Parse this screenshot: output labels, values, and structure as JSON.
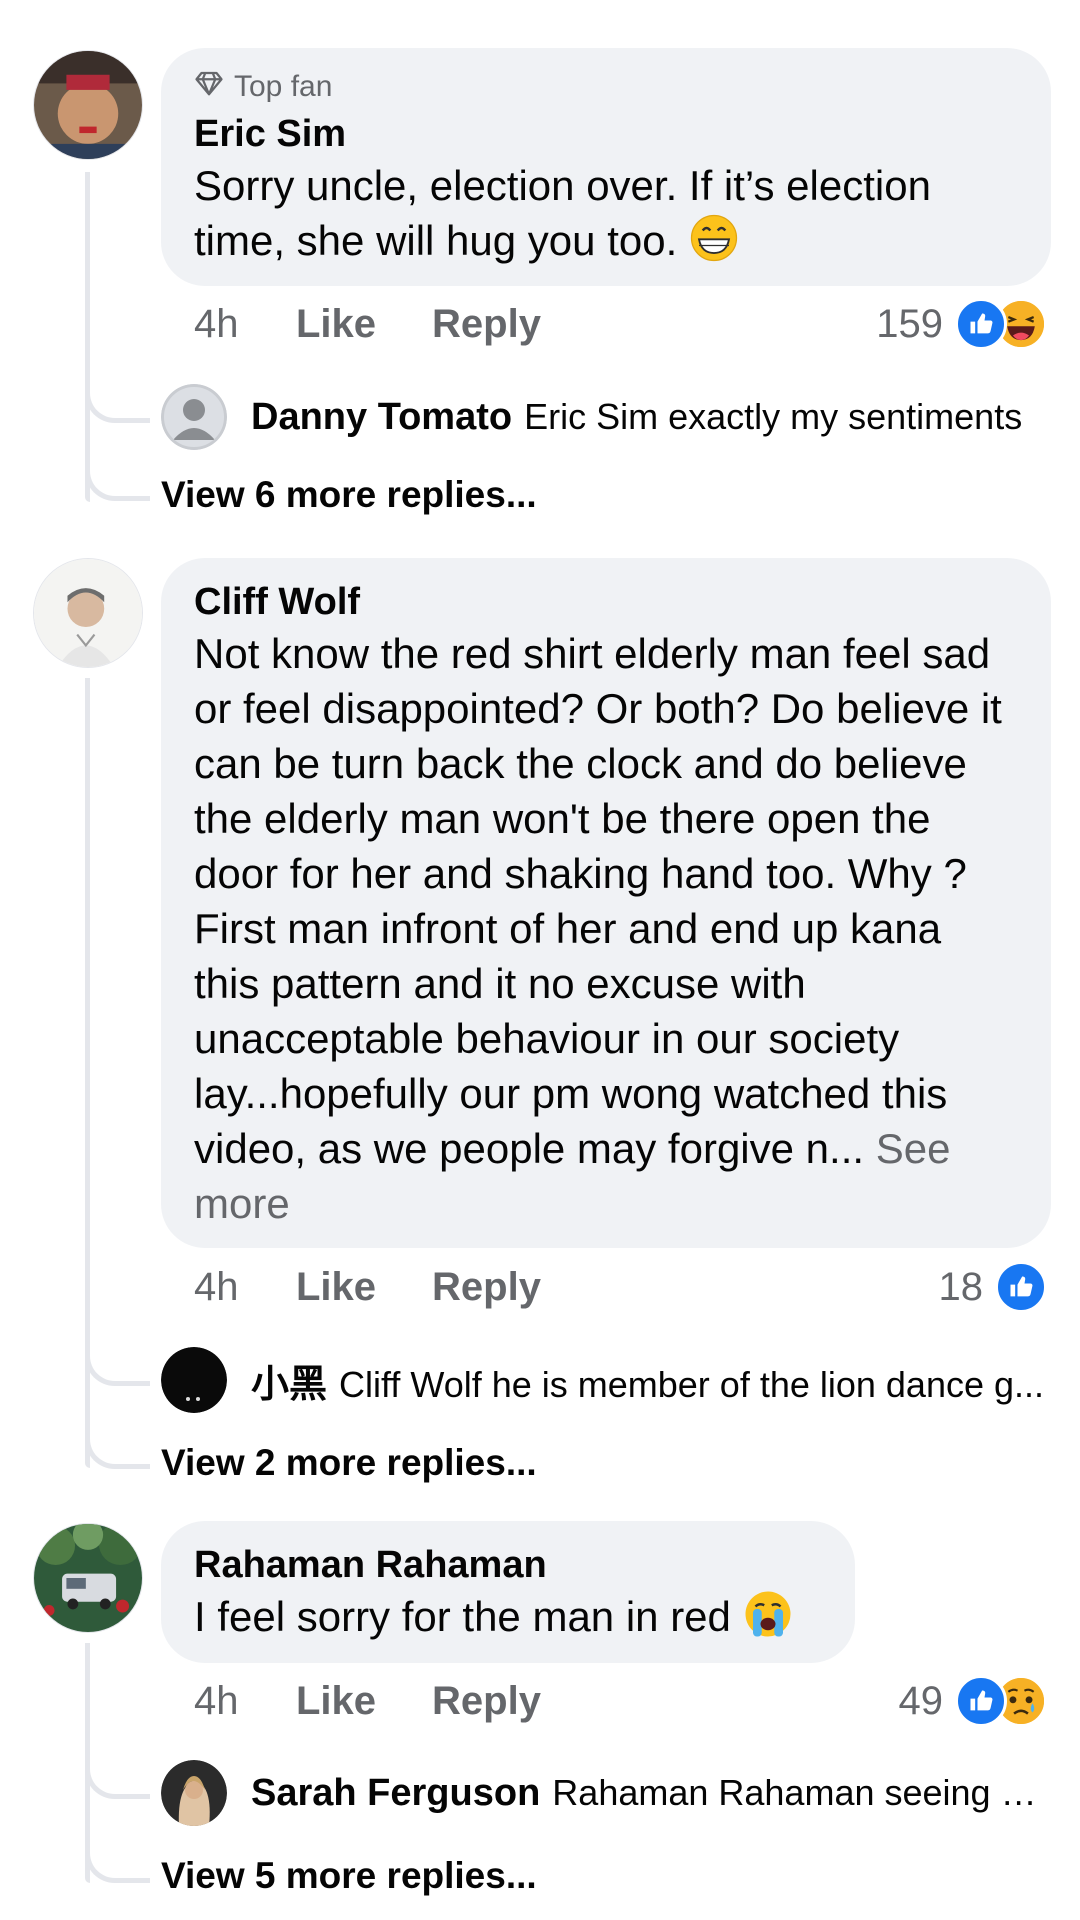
{
  "comments": [
    {
      "badge": "Top fan",
      "author": "Eric Sim",
      "text": "Sorry uncle, election over. If it’s election time, she will hug you too.",
      "time": "4h",
      "like_label": "Like",
      "reply_label": "Reply",
      "reaction_count": "159",
      "reactions": [
        "like-icon",
        "haha-icon"
      ],
      "reply": {
        "author": "Danny Tomato",
        "text": "Eric Sim exactly my sentiments"
      },
      "view_more": "View 6 more replies..."
    },
    {
      "author": "Cliff Wolf",
      "text": "Not know the red shirt elderly man feel sad or feel disappointed? Or both? Do believe it can be turn back the clock and do believe the elderly man won't be there open the door for her and shaking hand too. Why ? First man infront of her and end up kana this pattern and it no excuse with unacceptable behaviour in our society lay...hopefully our pm wong watched this video, as we people may forgive n...",
      "see_more": "See more",
      "time": "4h",
      "like_label": "Like",
      "reply_label": "Reply",
      "reaction_count": "18",
      "reactions": [
        "like-icon"
      ],
      "reply": {
        "author": "小黑",
        "text": "Cliff Wolf he is member of the lion dance g..."
      },
      "view_more": "View 2 more replies..."
    },
    {
      "author": "Rahaman Rahaman",
      "text": "I feel sorry for the man in red",
      "time": "4h",
      "like_label": "Like",
      "reply_label": "Reply",
      "reaction_count": "49",
      "reactions": [
        "like-icon",
        "sad-icon"
      ],
      "reply": {
        "author": "Sarah Ferguson",
        "text": "Rahaman Rahaman seeing his..."
      },
      "view_more": "View 5 more replies..."
    }
  ],
  "colors": {
    "bubble": "#f0f2f5",
    "secondary_text": "#65676b",
    "like_blue": "#1877f2"
  }
}
